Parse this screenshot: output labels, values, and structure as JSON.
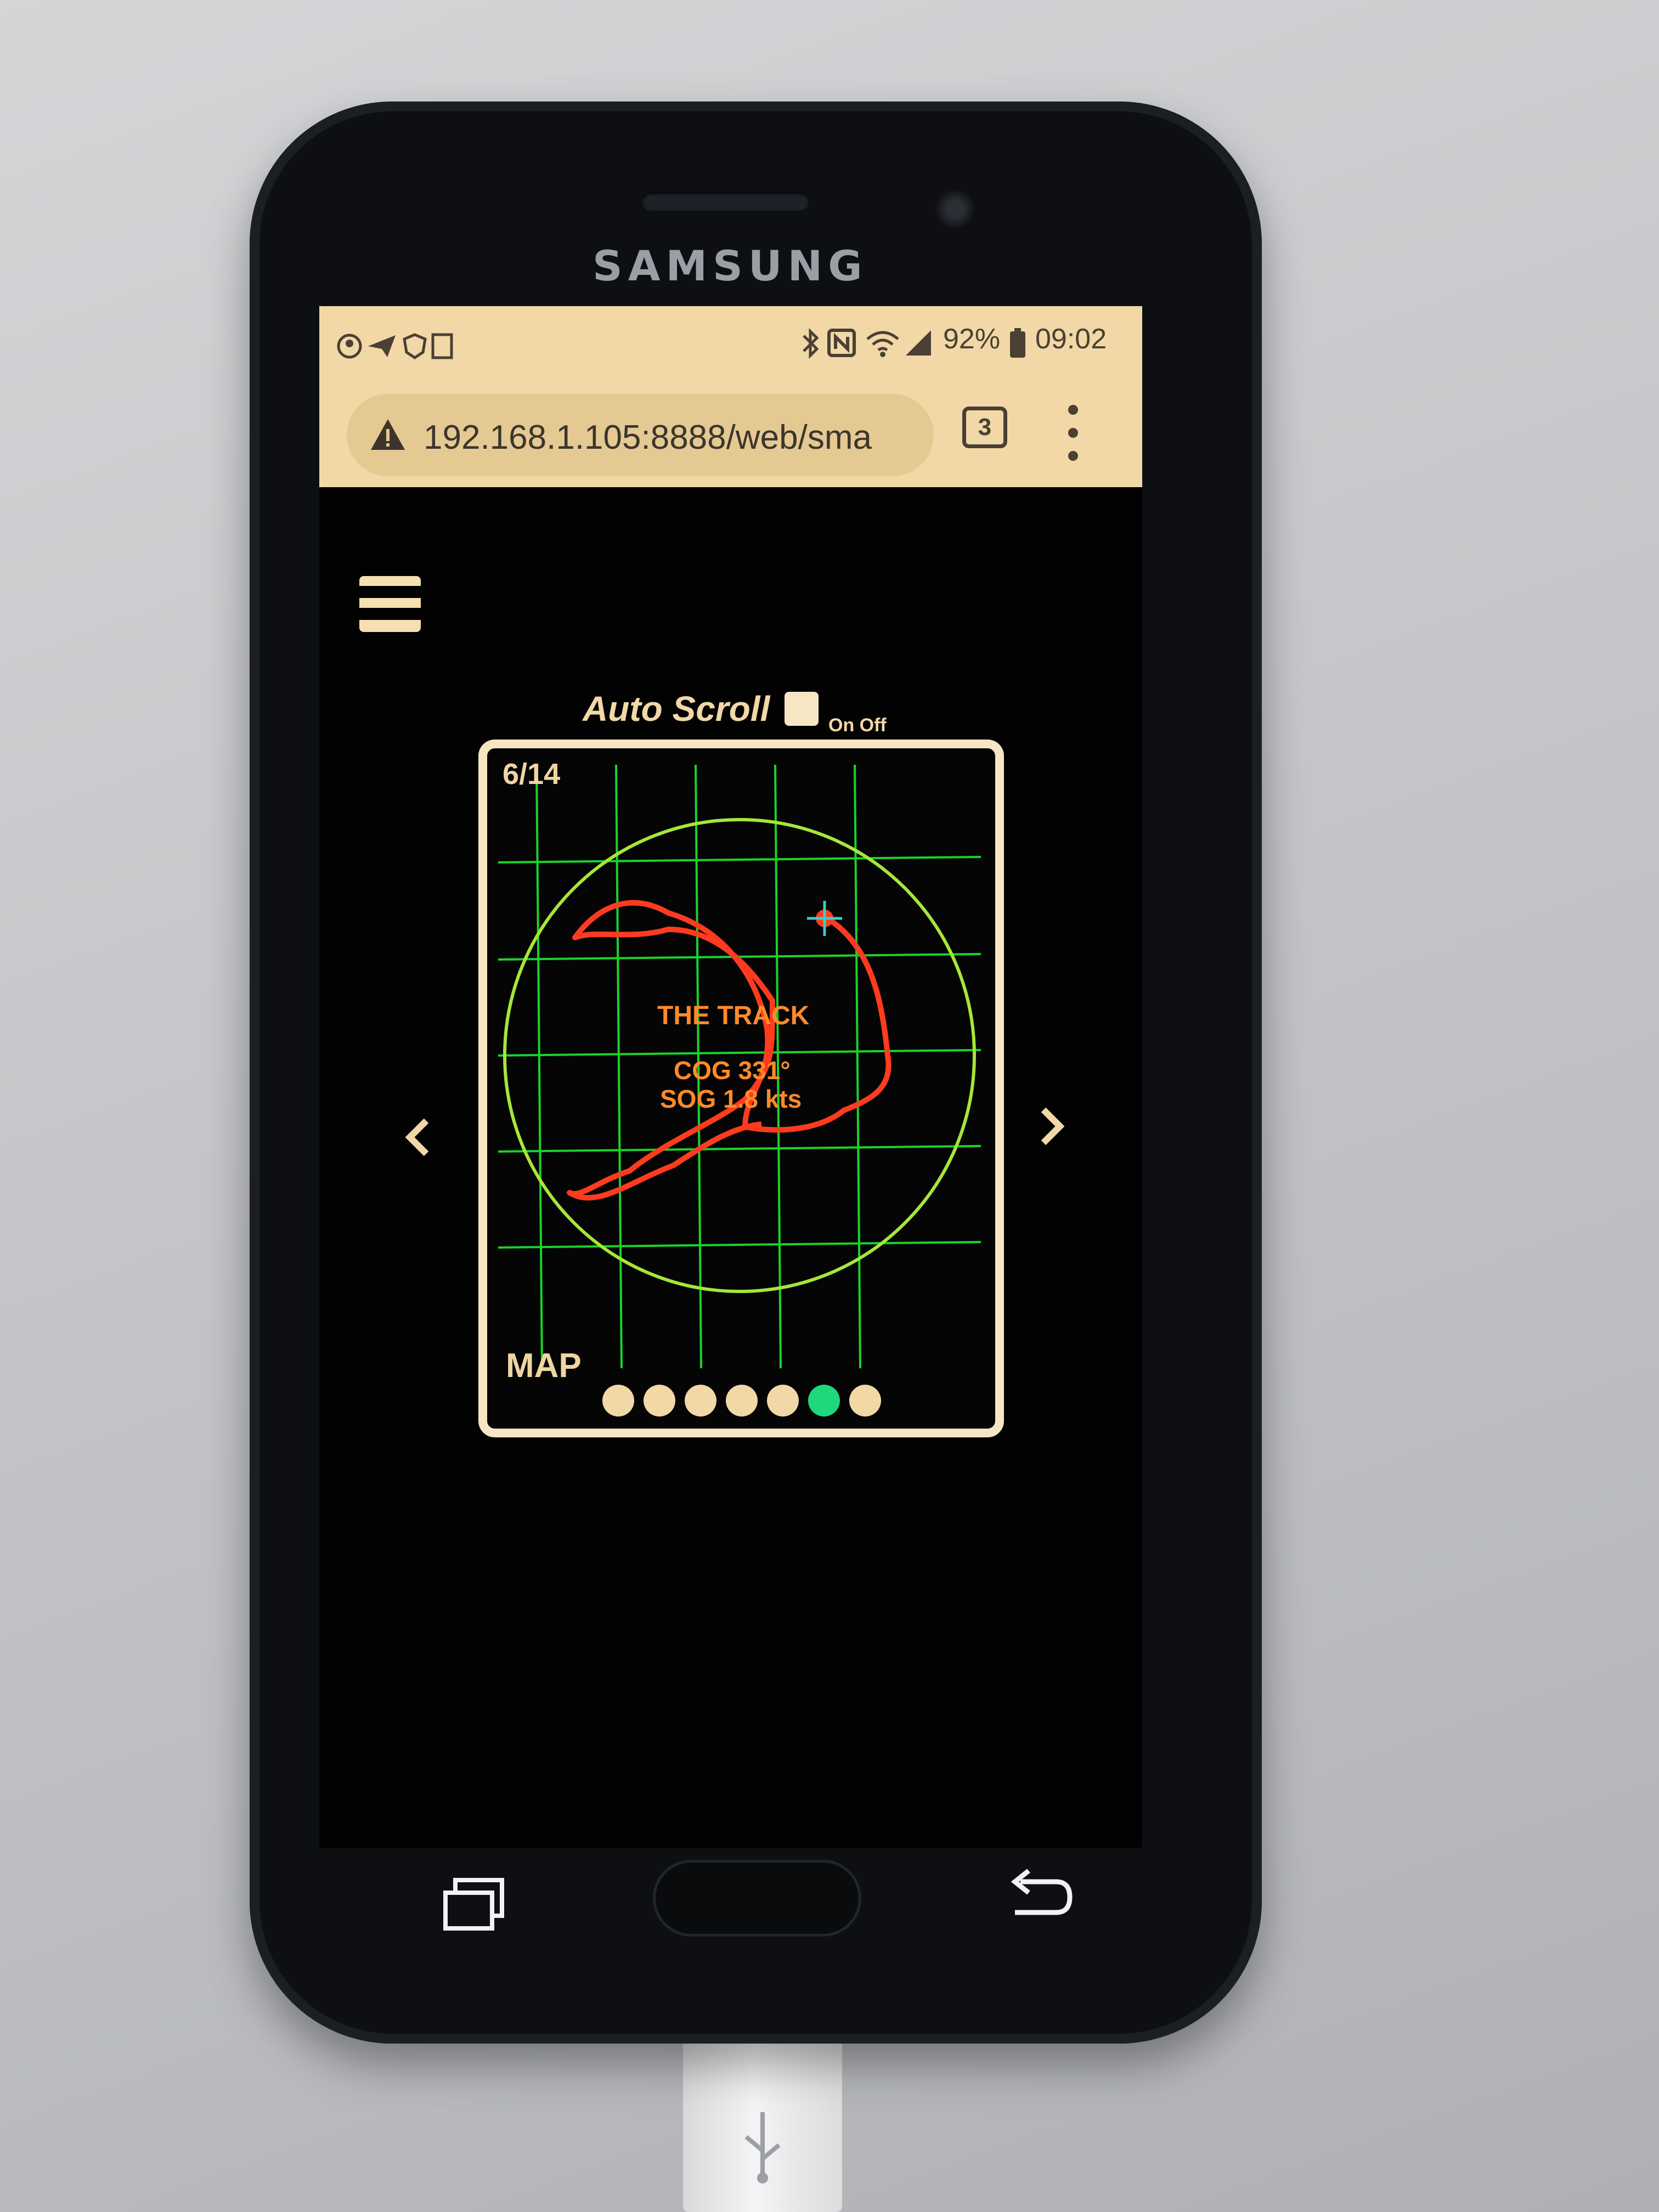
{
  "device": {
    "brand": "SAMSUNG"
  },
  "status_bar": {
    "left_icons": [
      "account-icon",
      "send-icon",
      "shield-icon",
      "sim-icon"
    ],
    "right_icons": [
      "bluetooth-icon",
      "nfc-icon",
      "wifi-icon",
      "signal-icon"
    ],
    "battery": "92%",
    "time": "09:02"
  },
  "browser": {
    "security_icon": "warning-icon",
    "url": "192.168.1.105:8888/web/sma",
    "tab_count": "3"
  },
  "app": {
    "auto_scroll_label": "Auto Scroll",
    "on_off_label": "On Off",
    "page_counter": "6/14",
    "card_title": "THE TRACK",
    "cog": "COG 331°",
    "sog": "SOG 1.8 kts",
    "map_label": "MAP",
    "pager": {
      "total_dots": 7,
      "active_index": 5
    },
    "colors": {
      "grid": "#18d42a",
      "ring": "#a6e63a",
      "track": "#ff3b1f",
      "marker": "#36d1c4",
      "accent": "#f1d8a6"
    }
  }
}
